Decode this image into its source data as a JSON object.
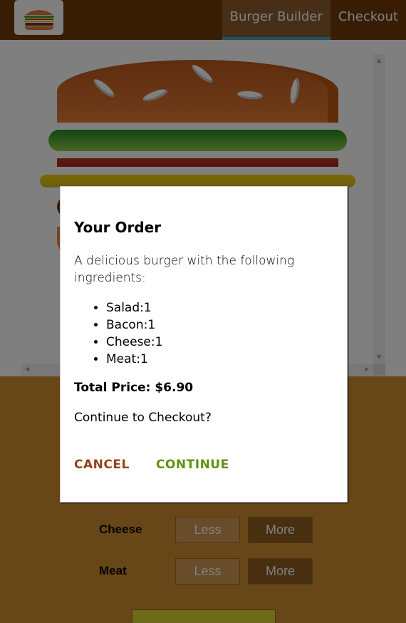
{
  "toolbar": {
    "logo_icon": "burger-logo-icon",
    "nav": [
      {
        "label": "Burger Builder",
        "active": true
      },
      {
        "label": "Checkout",
        "active": false
      }
    ]
  },
  "build_controls": [
    {
      "label": "Cheese",
      "less": "Less",
      "more": "More"
    },
    {
      "label": "Meat",
      "less": "Less",
      "more": "More"
    }
  ],
  "modal": {
    "title": "Your Order",
    "description": "A delicious burger with the following ingredients:",
    "ingredients": [
      "Salad:1",
      "Bacon:1",
      "Cheese:1",
      "Meat:1"
    ],
    "total_price": "Total Price: $6.90",
    "question": "Continue to Checkout?",
    "cancel_label": "CANCEL",
    "continue_label": "CONTINUE"
  },
  "colors": {
    "toolbar": "#703b09",
    "controls_bg": "#cf8f2e",
    "cancel": "#944317",
    "continue": "#5c9210",
    "active_underline": "#40a4c8"
  }
}
